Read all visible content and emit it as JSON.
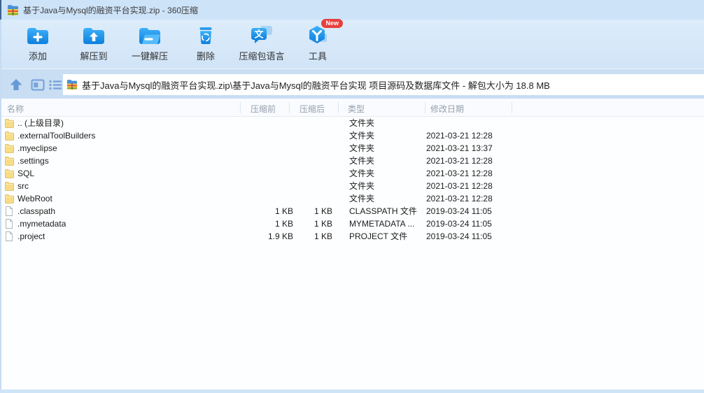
{
  "window": {
    "title": "基于Java与Mysql的融资平台实现.zip - 360压缩",
    "app_icon": "zip-archive-icon"
  },
  "toolbar": {
    "buttons": [
      {
        "label": "添加",
        "icon": "add-folder-icon"
      },
      {
        "label": "解压到",
        "icon": "extract-to-folder-icon"
      },
      {
        "label": "一键解压",
        "icon": "one-click-extract-icon"
      },
      {
        "label": "删除",
        "icon": "delete-trash-icon"
      },
      {
        "label": "压缩包语言",
        "icon": "archive-language-bubble-icon",
        "bubble_char": "文"
      },
      {
        "label": "工具",
        "icon": "tools-hexagon-icon",
        "badge": "New"
      }
    ]
  },
  "addressbar": {
    "nav_icons": [
      "up-arrow-icon",
      "preview-pane-icon",
      "list-view-icon"
    ],
    "path": "基于Java与Mysql的融资平台实现.zip\\基于Java与Mysql的融资平台实现 项目源码及数据库文件 - 解包大小为 18.8 MB"
  },
  "filelist": {
    "columns": [
      "名称",
      "压缩前",
      "压缩后",
      "类型",
      "修改日期"
    ],
    "rows": [
      {
        "name": ".. (上级目录)",
        "icon": "folder",
        "size_before": "",
        "size_after": "",
        "type": "文件夹",
        "modified": ""
      },
      {
        "name": ".externalToolBuilders",
        "icon": "folder",
        "size_before": "",
        "size_after": "",
        "type": "文件夹",
        "modified": "2021-03-21 12:28"
      },
      {
        "name": ".myeclipse",
        "icon": "folder",
        "size_before": "",
        "size_after": "",
        "type": "文件夹",
        "modified": "2021-03-21 13:37"
      },
      {
        "name": ".settings",
        "icon": "folder",
        "size_before": "",
        "size_after": "",
        "type": "文件夹",
        "modified": "2021-03-21 12:28"
      },
      {
        "name": "SQL",
        "icon": "folder",
        "size_before": "",
        "size_after": "",
        "type": "文件夹",
        "modified": "2021-03-21 12:28"
      },
      {
        "name": "src",
        "icon": "folder",
        "size_before": "",
        "size_after": "",
        "type": "文件夹",
        "modified": "2021-03-21 12:28"
      },
      {
        "name": "WebRoot",
        "icon": "folder",
        "size_before": "",
        "size_after": "",
        "type": "文件夹",
        "modified": "2021-03-21 12:28"
      },
      {
        "name": ".classpath",
        "icon": "file",
        "size_before": "1 KB",
        "size_after": "1 KB",
        "type": "CLASSPATH 文件",
        "modified": "2019-03-24 11:05"
      },
      {
        "name": ".mymetadata",
        "icon": "file",
        "size_before": "1 KB",
        "size_after": "1 KB",
        "type": "MYMETADATA ...",
        "modified": "2019-03-24 11:05"
      },
      {
        "name": ".project",
        "icon": "file",
        "size_before": "1.9 KB",
        "size_after": "1 KB",
        "type": "PROJECT 文件",
        "modified": "2019-03-24 11:05"
      }
    ]
  },
  "colors": {
    "titlebar_bg": "#cde3f8",
    "toolbar_bg": "#d6e7f9",
    "addressbar_bg": "#c9def3",
    "icon_blue": "#1b90e8",
    "badge_red": "#e7403c",
    "folder_yellow": "#f8dc86",
    "header_text": "#95a0ac",
    "row_text": "#1c1c1c"
  }
}
